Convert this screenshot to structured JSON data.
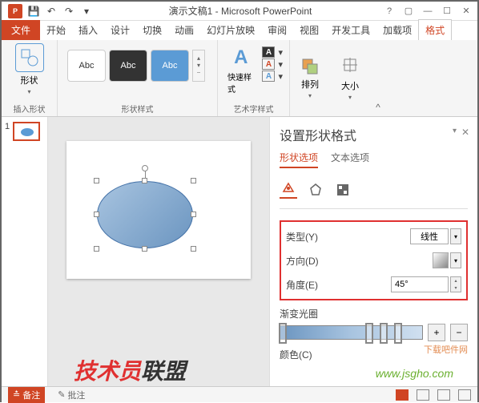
{
  "title": "演示文稿1 - Microsoft PowerPoint",
  "tabs": {
    "file": "文件",
    "home": "开始",
    "insert": "插入",
    "design": "设计",
    "transition": "切换",
    "animation": "动画",
    "slideshow": "幻灯片放映",
    "review": "审阅",
    "view": "视图",
    "developer": "开发工具",
    "addins": "加载项",
    "format": "格式"
  },
  "ribbon": {
    "insert_shape": {
      "label": "形状",
      "group": "插入形状"
    },
    "style_abc": "Abc",
    "shape_styles_group": "形状样式",
    "quick_style": "快速样式",
    "wordart_group": "艺术字样式",
    "arrange": "排列",
    "size": "大小"
  },
  "thumbs": {
    "n1": "1"
  },
  "pane": {
    "title": "设置形状格式",
    "tab_shape": "形状选项",
    "tab_text": "文本选项",
    "type_label": "类型(Y)",
    "type_value": "线性",
    "direction_label": "方向(D)",
    "angle_label": "角度(E)",
    "angle_value": "45°",
    "grad_stops": "渐变光圈",
    "color_label": "颜色(C)"
  },
  "statusbar": {
    "notes": "备注",
    "comments": "批注"
  },
  "watermarks": {
    "w1": "下载吧件网",
    "w2a": "技术员",
    "w2b": "联盟",
    "url": "www.jsgho.com"
  }
}
